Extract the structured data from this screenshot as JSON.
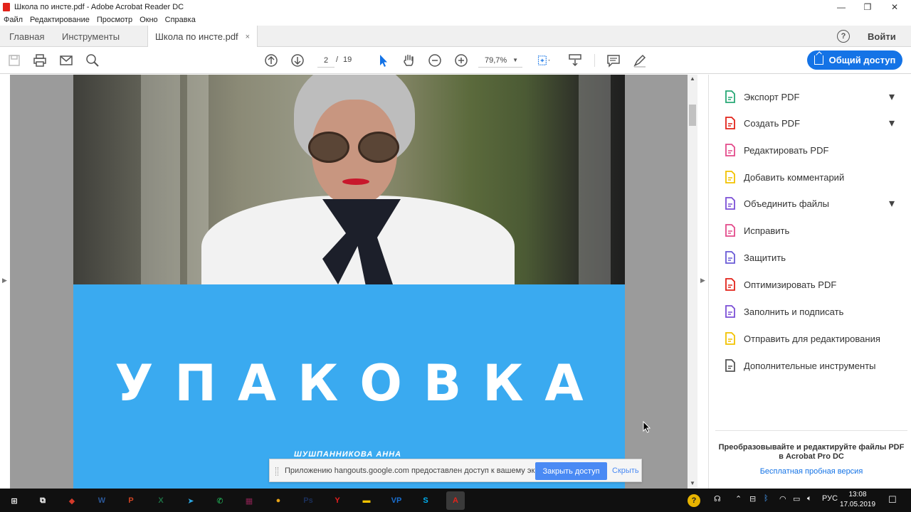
{
  "window": {
    "title": "Школа по инсте.pdf - Adobe Acrobat Reader DC",
    "minimize": "—",
    "maximize": "❐",
    "close": "✕"
  },
  "menu": [
    "Файл",
    "Редактирование",
    "Просмотр",
    "Окно",
    "Справка"
  ],
  "tabs": {
    "home": "Главная",
    "tools": "Инструменты",
    "document": "Школа по инсте.pdf",
    "close": "×",
    "help": "?",
    "login": "Войти"
  },
  "toolbar": {
    "current_page": "2",
    "page_separator": "/",
    "total_pages": "19",
    "zoom": "79,7%",
    "share": "Общий доступ"
  },
  "document": {
    "title": "УПАКОВКА",
    "author": "ШУШПАННИКОВА АННА"
  },
  "pane": {
    "items": [
      {
        "label": "Экспорт PDF",
        "icon": "export-pdf-icon",
        "color": "#27a775",
        "chevron": true
      },
      {
        "label": "Создать PDF",
        "icon": "create-pdf-icon",
        "color": "#e2231a",
        "chevron": true
      },
      {
        "label": "Редактировать PDF",
        "icon": "edit-pdf-icon",
        "color": "#e34a8a",
        "chevron": false
      },
      {
        "label": "Добавить комментарий",
        "icon": "comment-icon",
        "color": "#f2c200",
        "chevron": false
      },
      {
        "label": "Объединить файлы",
        "icon": "combine-files-icon",
        "color": "#7b4fd6",
        "chevron": true
      },
      {
        "label": "Исправить",
        "icon": "fix-icon",
        "color": "#e34a8a",
        "chevron": false
      },
      {
        "label": "Защитить",
        "icon": "protect-icon",
        "color": "#6a5bd6",
        "chevron": false
      },
      {
        "label": "Оптимизировать PDF",
        "icon": "optimize-pdf-icon",
        "color": "#e2231a",
        "chevron": false
      },
      {
        "label": "Заполнить и подписать",
        "icon": "fill-sign-icon",
        "color": "#7b4fd6",
        "chevron": false
      },
      {
        "label": "Отправить для редактирования",
        "icon": "send-review-icon",
        "color": "#f2c200",
        "chevron": false
      },
      {
        "label": "Дополнительные инструменты",
        "icon": "more-tools-icon",
        "color": "#555555",
        "chevron": false
      }
    ],
    "promo": "Преобразовывайте и редактируйте файлы PDF в Acrobat Pro DC",
    "trial": "Бесплатная пробная версия"
  },
  "notification": {
    "message": "Приложению hangouts.google.com предоставлен доступ к вашему экрану.",
    "stop": "Закрыть доступ",
    "hide": "Скрыть"
  },
  "taskbar": {
    "lang": "РУС",
    "time": "13:08",
    "date": "17.05.2019",
    "apps": [
      {
        "name": "start",
        "glyph": "⊞",
        "color": "#ffffff"
      },
      {
        "name": "task-view",
        "glyph": "⧉",
        "color": "#ffffff"
      },
      {
        "name": "app-pdf",
        "glyph": "◆",
        "color": "#d43a2a"
      },
      {
        "name": "word",
        "glyph": "W",
        "color": "#2b5797"
      },
      {
        "name": "powerpoint",
        "glyph": "P",
        "color": "#d04423"
      },
      {
        "name": "excel",
        "glyph": "X",
        "color": "#1e7145"
      },
      {
        "name": "telegram",
        "glyph": "➤",
        "color": "#2ca5e0"
      },
      {
        "name": "whatsapp",
        "glyph": "✆",
        "color": "#25d366"
      },
      {
        "name": "winrar",
        "glyph": "▦",
        "color": "#8b2252"
      },
      {
        "name": "chrome",
        "glyph": "●",
        "color": "#e8a317"
      },
      {
        "name": "photoshop",
        "glyph": "Ps",
        "color": "#1b2f5a"
      },
      {
        "name": "yandex",
        "glyph": "Y",
        "color": "#e51e1e"
      },
      {
        "name": "explorer",
        "glyph": "▬",
        "color": "#f2c200"
      },
      {
        "name": "vp",
        "glyph": "VP",
        "color": "#1a6fd0"
      },
      {
        "name": "skype",
        "glyph": "S",
        "color": "#00aff0"
      },
      {
        "name": "acrobat",
        "glyph": "A",
        "color": "#e2231a"
      }
    ]
  }
}
